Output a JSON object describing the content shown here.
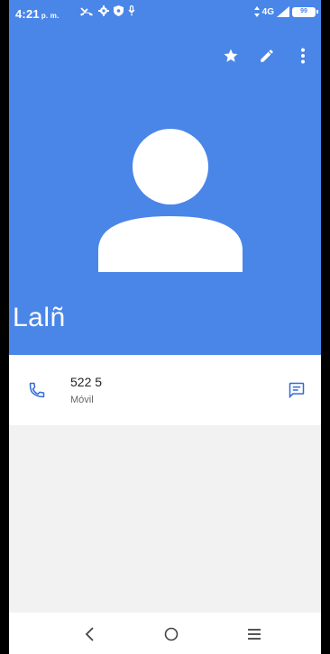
{
  "status_bar": {
    "time": "4:21",
    "ampm": "p. m.",
    "battery": "99",
    "network": "4G"
  },
  "header": {
    "actions": [
      "star-icon",
      "edit-icon",
      "more-vert-icon"
    ],
    "background_color": "#4a86e8"
  },
  "contact": {
    "name": "Lalñ"
  },
  "phone": {
    "number": "522 5",
    "type": "Móvil"
  },
  "nav": {
    "buttons": [
      "back-icon",
      "home-icon",
      "recents-icon"
    ]
  },
  "colors": {
    "accent": "#4a86e8",
    "icon_blue": "#2f6ad9"
  }
}
